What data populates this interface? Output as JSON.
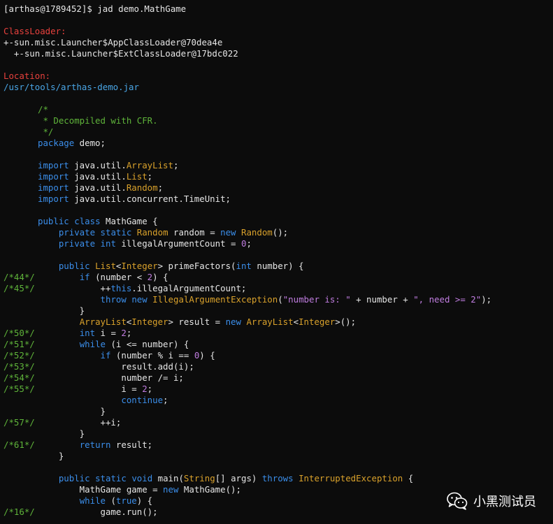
{
  "terminal": {
    "lines": [
      {
        "tokens": [
          {
            "t": "[arthas@1789452]$ jad demo.MathGame",
            "c": "plain"
          }
        ]
      },
      {
        "tokens": []
      },
      {
        "tokens": [
          {
            "t": "ClassLoader:",
            "c": "red"
          }
        ]
      },
      {
        "tokens": [
          {
            "t": "+-sun.misc.Launcher$AppClassLoader@70dea4e",
            "c": "plain"
          }
        ]
      },
      {
        "tokens": [
          {
            "t": "  +-sun.misc.Launcher$ExtClassLoader@17bdc022",
            "c": "plain"
          }
        ]
      },
      {
        "tokens": []
      },
      {
        "tokens": [
          {
            "t": "Location:",
            "c": "red"
          }
        ]
      },
      {
        "tokens": [
          {
            "t": "/usr/tools/arthas-demo.jar",
            "c": "path"
          }
        ]
      },
      {
        "tokens": []
      },
      {
        "tokens": [
          {
            "t": "/*",
            "c": "cmt"
          }
        ]
      },
      {
        "tokens": [
          {
            "t": " * Decompiled with CFR.",
            "c": "cmt"
          }
        ]
      },
      {
        "tokens": [
          {
            "t": " */",
            "c": "cmt"
          }
        ]
      },
      {
        "tokens": [
          {
            "t": "package",
            "c": "kw"
          },
          {
            "t": " demo;",
            "c": "plain"
          }
        ]
      },
      {
        "tokens": []
      },
      {
        "tokens": [
          {
            "t": "import",
            "c": "kw"
          },
          {
            "t": " java.util.",
            "c": "plain"
          },
          {
            "t": "ArrayList",
            "c": "type"
          },
          {
            "t": ";",
            "c": "plain"
          }
        ]
      },
      {
        "tokens": [
          {
            "t": "import",
            "c": "kw"
          },
          {
            "t": " java.util.",
            "c": "plain"
          },
          {
            "t": "List",
            "c": "type"
          },
          {
            "t": ";",
            "c": "plain"
          }
        ]
      },
      {
        "tokens": [
          {
            "t": "import",
            "c": "kw"
          },
          {
            "t": " java.util.",
            "c": "plain"
          },
          {
            "t": "Random",
            "c": "type"
          },
          {
            "t": ";",
            "c": "plain"
          }
        ]
      },
      {
        "tokens": [
          {
            "t": "import",
            "c": "kw"
          },
          {
            "t": " java.util.concurrent.TimeUnit;",
            "c": "plain"
          }
        ]
      },
      {
        "tokens": []
      },
      {
        "tokens": [
          {
            "t": "public",
            "c": "kw"
          },
          {
            "t": " ",
            "c": "plain"
          },
          {
            "t": "class",
            "c": "kw"
          },
          {
            "t": " MathGame {",
            "c": "plain"
          }
        ]
      },
      {
        "tokens": [
          {
            "t": "    ",
            "c": "plain"
          },
          {
            "t": "private",
            "c": "kw"
          },
          {
            "t": " ",
            "c": "plain"
          },
          {
            "t": "static",
            "c": "kw"
          },
          {
            "t": " ",
            "c": "plain"
          },
          {
            "t": "Random",
            "c": "type"
          },
          {
            "t": " random = ",
            "c": "plain"
          },
          {
            "t": "new",
            "c": "kw"
          },
          {
            "t": " ",
            "c": "plain"
          },
          {
            "t": "Random",
            "c": "type"
          },
          {
            "t": "();",
            "c": "plain"
          }
        ]
      },
      {
        "tokens": [
          {
            "t": "    ",
            "c": "plain"
          },
          {
            "t": "private",
            "c": "kw"
          },
          {
            "t": " ",
            "c": "plain"
          },
          {
            "t": "int",
            "c": "kw"
          },
          {
            "t": " illegalArgumentCount = ",
            "c": "plain"
          },
          {
            "t": "0",
            "c": "num"
          },
          {
            "t": ";",
            "c": "plain"
          }
        ]
      },
      {
        "tokens": []
      },
      {
        "tokens": [
          {
            "t": "    ",
            "c": "plain"
          },
          {
            "t": "public",
            "c": "kw"
          },
          {
            "t": " ",
            "c": "plain"
          },
          {
            "t": "List",
            "c": "type"
          },
          {
            "t": "<",
            "c": "plain"
          },
          {
            "t": "Integer",
            "c": "type"
          },
          {
            "t": "> primeFactors(",
            "c": "plain"
          },
          {
            "t": "int",
            "c": "kw"
          },
          {
            "t": " number) {",
            "c": "plain"
          }
        ]
      },
      {
        "no": "/*44*/",
        "tokens": [
          {
            "t": "        ",
            "c": "plain"
          },
          {
            "t": "if",
            "c": "kw"
          },
          {
            "t": " (number < ",
            "c": "plain"
          },
          {
            "t": "2",
            "c": "num"
          },
          {
            "t": ") {",
            "c": "plain"
          }
        ]
      },
      {
        "no": "/*45*/",
        "tokens": [
          {
            "t": "            ++",
            "c": "plain"
          },
          {
            "t": "this",
            "c": "kw"
          },
          {
            "t": ".illegalArgumentCount;",
            "c": "plain"
          }
        ]
      },
      {
        "tokens": [
          {
            "t": "            ",
            "c": "plain"
          },
          {
            "t": "throw",
            "c": "kw"
          },
          {
            "t": " ",
            "c": "plain"
          },
          {
            "t": "new",
            "c": "kw"
          },
          {
            "t": " ",
            "c": "plain"
          },
          {
            "t": "IllegalArgumentException",
            "c": "type"
          },
          {
            "t": "(",
            "c": "plain"
          },
          {
            "t": "\"number is: \"",
            "c": "str"
          },
          {
            "t": " + number + ",
            "c": "plain"
          },
          {
            "t": "\", need >= 2\"",
            "c": "str"
          },
          {
            "t": ");",
            "c": "plain"
          }
        ]
      },
      {
        "tokens": [
          {
            "t": "        }",
            "c": "plain"
          }
        ]
      },
      {
        "tokens": [
          {
            "t": "        ",
            "c": "plain"
          },
          {
            "t": "ArrayList",
            "c": "type"
          },
          {
            "t": "<",
            "c": "plain"
          },
          {
            "t": "Integer",
            "c": "type"
          },
          {
            "t": "> result = ",
            "c": "plain"
          },
          {
            "t": "new",
            "c": "kw"
          },
          {
            "t": " ",
            "c": "plain"
          },
          {
            "t": "ArrayList",
            "c": "type"
          },
          {
            "t": "<",
            "c": "plain"
          },
          {
            "t": "Integer",
            "c": "type"
          },
          {
            "t": ">();",
            "c": "plain"
          }
        ]
      },
      {
        "no": "/*50*/",
        "tokens": [
          {
            "t": "        ",
            "c": "plain"
          },
          {
            "t": "int",
            "c": "kw"
          },
          {
            "t": " i = ",
            "c": "plain"
          },
          {
            "t": "2",
            "c": "num"
          },
          {
            "t": ";",
            "c": "plain"
          }
        ]
      },
      {
        "no": "/*51*/",
        "tokens": [
          {
            "t": "        ",
            "c": "plain"
          },
          {
            "t": "while",
            "c": "kw"
          },
          {
            "t": " (i <= number) {",
            "c": "plain"
          }
        ]
      },
      {
        "no": "/*52*/",
        "tokens": [
          {
            "t": "            ",
            "c": "plain"
          },
          {
            "t": "if",
            "c": "kw"
          },
          {
            "t": " (number % i == ",
            "c": "plain"
          },
          {
            "t": "0",
            "c": "num"
          },
          {
            "t": ") {",
            "c": "plain"
          }
        ]
      },
      {
        "no": "/*53*/",
        "tokens": [
          {
            "t": "                result.add(i);",
            "c": "plain"
          }
        ]
      },
      {
        "no": "/*54*/",
        "tokens": [
          {
            "t": "                number /= i;",
            "c": "plain"
          }
        ]
      },
      {
        "no": "/*55*/",
        "tokens": [
          {
            "t": "                i = ",
            "c": "plain"
          },
          {
            "t": "2",
            "c": "num"
          },
          {
            "t": ";",
            "c": "plain"
          }
        ]
      },
      {
        "tokens": [
          {
            "t": "                ",
            "c": "plain"
          },
          {
            "t": "continue",
            "c": "kw"
          },
          {
            "t": ";",
            "c": "plain"
          }
        ]
      },
      {
        "tokens": [
          {
            "t": "            }",
            "c": "plain"
          }
        ]
      },
      {
        "no": "/*57*/",
        "tokens": [
          {
            "t": "            ++i;",
            "c": "plain"
          }
        ]
      },
      {
        "tokens": [
          {
            "t": "        }",
            "c": "plain"
          }
        ]
      },
      {
        "no": "/*61*/",
        "tokens": [
          {
            "t": "        ",
            "c": "plain"
          },
          {
            "t": "return",
            "c": "kw"
          },
          {
            "t": " result;",
            "c": "plain"
          }
        ]
      },
      {
        "tokens": [
          {
            "t": "    }",
            "c": "plain"
          }
        ]
      },
      {
        "tokens": []
      },
      {
        "tokens": [
          {
            "t": "    ",
            "c": "plain"
          },
          {
            "t": "public",
            "c": "kw"
          },
          {
            "t": " ",
            "c": "plain"
          },
          {
            "t": "static",
            "c": "kw"
          },
          {
            "t": " ",
            "c": "plain"
          },
          {
            "t": "void",
            "c": "kw"
          },
          {
            "t": " main(",
            "c": "plain"
          },
          {
            "t": "String",
            "c": "type"
          },
          {
            "t": "[] args) ",
            "c": "plain"
          },
          {
            "t": "throws",
            "c": "kw"
          },
          {
            "t": " ",
            "c": "plain"
          },
          {
            "t": "InterruptedException",
            "c": "type"
          },
          {
            "t": " {",
            "c": "plain"
          }
        ]
      },
      {
        "tokens": [
          {
            "t": "        MathGame game = ",
            "c": "plain"
          },
          {
            "t": "new",
            "c": "kw"
          },
          {
            "t": " MathGame();",
            "c": "plain"
          }
        ]
      },
      {
        "tokens": [
          {
            "t": "        ",
            "c": "plain"
          },
          {
            "t": "while",
            "c": "kw"
          },
          {
            "t": " (",
            "c": "plain"
          },
          {
            "t": "true",
            "c": "kw"
          },
          {
            "t": ") {",
            "c": "plain"
          }
        ]
      },
      {
        "no": "/*16*/",
        "tokens": [
          {
            "t": "            game.run();",
            "c": "plain"
          }
        ]
      }
    ],
    "code_indent_from_line": 9
  },
  "watermark": {
    "icon": "wechat-icon",
    "text": "小黑测试员"
  },
  "colors": {
    "background": "#0c0c0c",
    "text": "#e6e6e6",
    "label_red": "#e8413d",
    "keyword_blue": "#3b8eea",
    "type_yellow": "#d9a12b",
    "number_purple": "#c07de0",
    "comment_green": "#5fb43a"
  }
}
